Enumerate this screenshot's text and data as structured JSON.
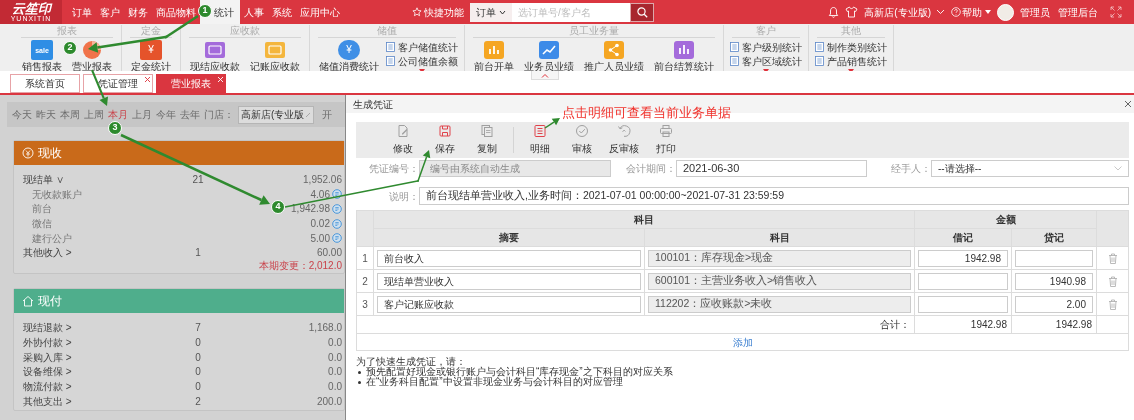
{
  "top_bar": {
    "logo": "云笙印",
    "logo_tagline": "YUNXITIN",
    "nav": [
      {
        "label": "订单",
        "selected": false
      },
      {
        "label": "客户",
        "selected": false
      },
      {
        "label": "财务",
        "selected": false
      },
      {
        "label": "商品物料",
        "selected": false
      },
      {
        "label": "统计",
        "selected": true
      },
      {
        "label": "人事",
        "selected": false
      },
      {
        "label": "系统",
        "selected": false
      },
      {
        "label": "应用中心",
        "selected": false
      }
    ],
    "quick": "快捷功能",
    "search": {
      "scope": "订单",
      "placeholder": "选订单号/客户名"
    },
    "store": "高新店(专业版)",
    "help": "帮助",
    "user": "管理员",
    "admin": "管理后台"
  },
  "ribbon": {
    "groups": [
      {
        "title": "报表",
        "has_more": false,
        "items": [
          {
            "kind": "big",
            "label": "销售报表",
            "icon_text": "sale"
          },
          {
            "kind": "big",
            "label": "营业报表"
          }
        ]
      },
      {
        "title": "定金",
        "has_more": false,
        "items": [
          {
            "kind": "big",
            "label": "定金统计",
            "icon_text": "¥"
          }
        ]
      },
      {
        "title": "应收款",
        "has_more": false,
        "items": [
          {
            "kind": "big",
            "label": "现结应收款"
          },
          {
            "kind": "big",
            "label": "记账应收款"
          }
        ]
      },
      {
        "title": "储值",
        "has_more": true,
        "items": [
          {
            "kind": "big",
            "label": "储值消费统计",
            "icon_text": "¥"
          },
          {
            "kind": "small",
            "label": "客户储值统计"
          },
          {
            "kind": "small",
            "label": "公司储值余额"
          }
        ]
      },
      {
        "title": "员工业务量",
        "has_more": false,
        "items": [
          {
            "kind": "big",
            "label": "前台开单"
          },
          {
            "kind": "big",
            "label": "业务员业绩"
          },
          {
            "kind": "big",
            "label": "推广人员业绩"
          },
          {
            "kind": "big",
            "label": "前台结算统计"
          }
        ]
      },
      {
        "title": "客户",
        "has_more": true,
        "items": [
          {
            "kind": "small",
            "label": "客户级别统计"
          },
          {
            "kind": "small",
            "label": "客户区域统计"
          }
        ]
      },
      {
        "title": "其他",
        "has_more": true,
        "items": [
          {
            "kind": "small",
            "label": "制作类别统计"
          },
          {
            "kind": "small",
            "label": "产品销售统计"
          }
        ]
      }
    ]
  },
  "tabs": [
    {
      "label": "系统首页",
      "selected": false,
      "closable": false
    },
    {
      "label": "凭证管理",
      "selected": false,
      "closable": true
    },
    {
      "label": "营业报表",
      "selected": true,
      "closable": true
    }
  ],
  "filter": {
    "periods": [
      {
        "label": "今天",
        "selected": false
      },
      {
        "label": "昨天",
        "selected": false
      },
      {
        "label": "本周",
        "selected": false
      },
      {
        "label": "上周",
        "selected": false
      },
      {
        "label": "本月",
        "selected": true
      },
      {
        "label": "上月",
        "selected": false
      },
      {
        "label": "今年",
        "selected": false
      },
      {
        "label": "去年",
        "selected": false
      }
    ],
    "store_label": "门店：",
    "store_value": "高新店(专业版",
    "next_label": "开"
  },
  "income": {
    "title": "现收",
    "rows": [
      {
        "kind": "main",
        "label": "现结单 ∨",
        "count": "21",
        "amount": "1,952.06"
      },
      {
        "kind": "sub",
        "label": "无收款账户",
        "amount": "4.06"
      },
      {
        "kind": "sub",
        "label": "前台",
        "amount": "1,942.98"
      },
      {
        "kind": "sub",
        "label": "微信",
        "amount": "0.02"
      },
      {
        "kind": "sub",
        "label": "建行公户",
        "amount": "5.00"
      },
      {
        "kind": "main",
        "label": "其他收入 >",
        "count": "1",
        "amount": "60.00"
      }
    ],
    "total": "本期变更：2,012.0"
  },
  "payments": {
    "title": "现付",
    "rows": [
      {
        "label": "现结退款 >",
        "count": "7",
        "amount": "1,168.0"
      },
      {
        "label": "外协付款 >",
        "count": "0",
        "amount": "0.0"
      },
      {
        "label": "采购入库 >",
        "count": "0",
        "amount": "0.0"
      },
      {
        "label": "设备维保 >",
        "count": "0",
        "amount": "0.0"
      },
      {
        "label": "物流付款 >",
        "count": "0",
        "amount": "0.0"
      },
      {
        "label": "其他支出 >",
        "count": "2",
        "amount": "200.0"
      }
    ]
  },
  "dialog": {
    "title": "生成凭证",
    "toolbar": [
      {
        "label": "修改",
        "highlighted": false
      },
      {
        "label": "保存",
        "highlighted": true
      },
      {
        "label": "复制",
        "highlighted": false
      },
      {
        "label": "明细",
        "highlighted": true
      },
      {
        "label": "审核",
        "highlighted": false
      },
      {
        "label": "反审核",
        "highlighted": false
      },
      {
        "label": "打印",
        "highlighted": false
      }
    ],
    "voucher_no": {
      "label": "凭证编号：",
      "placeholder": "编号由系统自动生成",
      "disabled": true
    },
    "period": {
      "label": "会计期间：",
      "value": "2021-06-30"
    },
    "handler": {
      "label": "经手人：",
      "value": "--请选择--"
    },
    "description": {
      "label": "说明：",
      "value": "前台现结单营业收入,业务时间：2021-07-01 00:00:00~2021-07-31 23:59:59"
    },
    "table": {
      "group_headers": [
        "科目",
        "金额"
      ],
      "columns": [
        "摘要",
        "科目",
        "借记",
        "贷记"
      ],
      "rows": [
        {
          "no": "1",
          "summary": "前台收入",
          "account": "100101：库存现金>现金",
          "debit": "1942.98"
        },
        {
          "no": "2",
          "summary": "现结单营业收入",
          "account": "600101：主营业务收入>销售收入",
          "credit": "1940.98"
        },
        {
          "no": "3",
          "summary": "客户记账应收款",
          "account": "112202：应收账款>未收",
          "credit": "2.00"
        }
      ],
      "total": {
        "label": "合计：",
        "debit": "1942.98",
        "credit": "1942.98"
      },
      "add": "添加"
    },
    "notes": {
      "intro": "为了快速生成凭证，请：",
      "items": [
        "预先配置好现金或银行账户与会计科目“库存现金”之下科目的对应关系",
        "在“业务科目配置”中设置非现金业务与会计科目的对应管理"
      ]
    }
  },
  "annotations": {
    "steps": [
      "1",
      "2",
      "3",
      "4"
    ],
    "note": "点击明细可查看当前业务单据"
  }
}
